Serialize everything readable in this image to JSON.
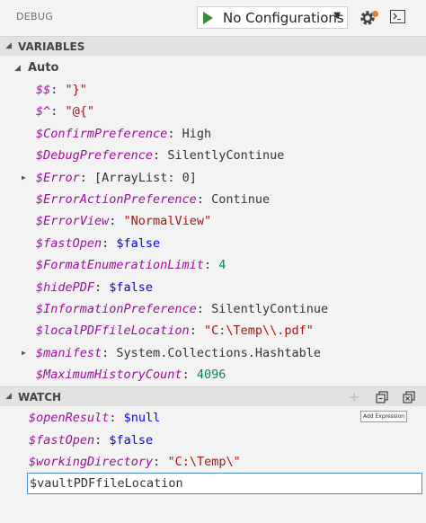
{
  "toolbar": {
    "title": "DEBUG",
    "config_label": "No Configurations",
    "config_caret": "▼",
    "colors": {
      "play": "#388a34",
      "notification_dot": "#e97a2c"
    },
    "icons": [
      "play-icon",
      "gear-icon",
      "console-icon"
    ]
  },
  "variables": {
    "header": "VARIABLES",
    "scope": "Auto",
    "items": [
      {
        "name": "$$",
        "value": "\"}\"",
        "kind": "str",
        "expandable": false
      },
      {
        "name": "$^",
        "value": "\"@{\"",
        "kind": "str",
        "expandable": false
      },
      {
        "name": "$ConfirmPreference",
        "value": "High",
        "kind": "plain",
        "expandable": false
      },
      {
        "name": "$DebugPreference",
        "value": "SilentlyContinue",
        "kind": "plain",
        "expandable": false
      },
      {
        "name": "$Error",
        "value": "[ArrayList: 0]",
        "kind": "plain",
        "expandable": true
      },
      {
        "name": "$ErrorActionPreference",
        "value": "Continue",
        "kind": "plain",
        "expandable": false
      },
      {
        "name": "$ErrorView",
        "value": "\"NormalView\"",
        "kind": "str",
        "expandable": false
      },
      {
        "name": "$fastOpen",
        "value": "$false",
        "kind": "var",
        "expandable": false
      },
      {
        "name": "$FormatEnumerationLimit",
        "value": "4",
        "kind": "num",
        "expandable": false
      },
      {
        "name": "$hidePDF",
        "value": "$false",
        "kind": "var",
        "expandable": false
      },
      {
        "name": "$InformationPreference",
        "value": "SilentlyContinue",
        "kind": "plain",
        "expandable": false
      },
      {
        "name": "$localPDFfileLocation",
        "value": "\"C:\\Temp\\\\.pdf\"",
        "kind": "str",
        "expandable": false
      },
      {
        "name": "$manifest",
        "value": "System.Collections.Hashtable",
        "kind": "plain",
        "expandable": true
      },
      {
        "name": "$MaximumHistoryCount",
        "value": "4096",
        "kind": "num",
        "expandable": false
      }
    ]
  },
  "watch": {
    "header": "WATCH",
    "tooltip": "Add Expression",
    "tool_icons": [
      "add-icon",
      "collapse-all-icon",
      "remove-all-icon"
    ],
    "items": [
      {
        "name": "$openResult",
        "value": "$null",
        "kind": "var"
      },
      {
        "name": "$fastOpen",
        "value": "$false",
        "kind": "var"
      },
      {
        "name": "$workingDirectory",
        "value": "\"C:\\Temp\\\"",
        "kind": "str"
      }
    ],
    "input_value": "$vaultPDFfileLocation"
  }
}
